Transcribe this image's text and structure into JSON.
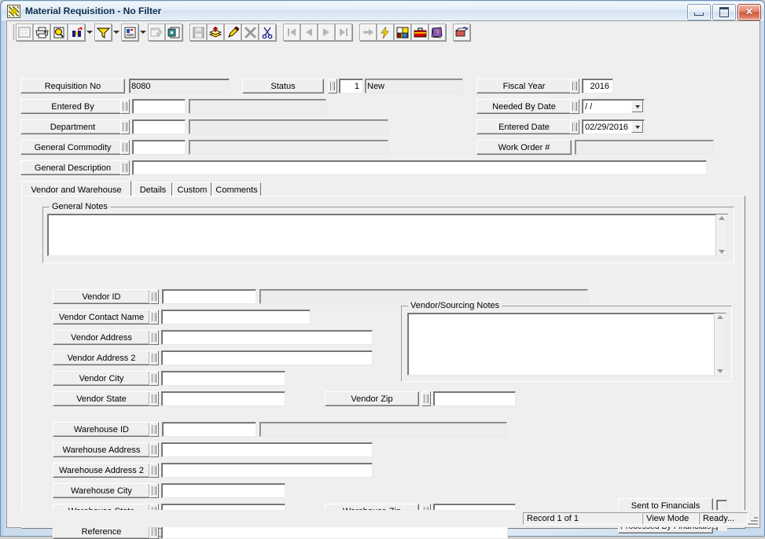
{
  "window": {
    "title": "Material Requisition - No Filter",
    "icon": "application-icon",
    "buttons": [
      {
        "name": "minimize-button",
        "label": "Minimize"
      },
      {
        "name": "maximize-button",
        "label": "Maximize"
      },
      {
        "name": "close-button",
        "label": "Close"
      }
    ]
  },
  "toolbar": {
    "items": [
      {
        "name": "grid-view-button",
        "icon": "grid-icon",
        "enabled": false
      },
      {
        "name": "print-button",
        "icon": "printer-icon",
        "enabled": true
      },
      {
        "name": "print-preview-button",
        "icon": "magnifier-page-icon",
        "enabled": true
      },
      {
        "name": "find-button",
        "icon": "binoculars-icon",
        "enabled": true
      },
      {
        "name": "find-dropdown",
        "icon": "chevron-down-icon",
        "enabled": true
      },
      {
        "name": "filter-button",
        "icon": "funnel-icon",
        "enabled": true
      },
      {
        "name": "filter-dropdown",
        "icon": "chevron-down-icon",
        "enabled": true
      },
      {
        "name": "report-button",
        "icon": "document-report-icon",
        "enabled": true
      },
      {
        "name": "report-dropdown",
        "icon": "chevron-down-icon",
        "enabled": true
      },
      {
        "name": "properties-button",
        "icon": "window-properties-icon",
        "enabled": false
      },
      {
        "name": "export-button",
        "icon": "export-page-icon",
        "enabled": true
      },
      {
        "name": "save-button",
        "icon": "floppy-disk-icon",
        "enabled": false
      },
      {
        "name": "add-record-button",
        "icon": "add-layers-icon",
        "enabled": true
      },
      {
        "name": "edit-record-button",
        "icon": "pencil-icon",
        "enabled": true
      },
      {
        "name": "delete-record-button",
        "icon": "x-delete-icon",
        "enabled": false
      },
      {
        "name": "cut-button",
        "icon": "scissors-icon",
        "enabled": true
      },
      {
        "name": "first-record-button",
        "icon": "first-record-icon",
        "enabled": false
      },
      {
        "name": "previous-record-button",
        "icon": "previous-record-icon",
        "enabled": false
      },
      {
        "name": "next-record-button",
        "icon": "next-record-icon",
        "enabled": false
      },
      {
        "name": "last-record-button",
        "icon": "last-record-icon",
        "enabled": false
      },
      {
        "name": "goto-button",
        "icon": "arrow-right-icon",
        "enabled": false
      },
      {
        "name": "quick-action-button",
        "icon": "lightning-bolt-icon",
        "enabled": true
      },
      {
        "name": "attachments-button",
        "icon": "paint-palette-icon",
        "enabled": true
      },
      {
        "name": "toolbox-button",
        "icon": "toolbox-icon",
        "enabled": true
      },
      {
        "name": "help-button",
        "icon": "help-book-icon",
        "enabled": true
      },
      {
        "name": "exit-button",
        "icon": "exit-door-icon",
        "enabled": true
      }
    ]
  },
  "header": {
    "requisition_no": {
      "label": "Requisition No",
      "value": "8080"
    },
    "status": {
      "label": "Status",
      "code": "1",
      "description": "New"
    },
    "entered_by": {
      "label": "Entered By",
      "value": "",
      "desc": ""
    },
    "department": {
      "label": "Department",
      "value": "",
      "desc": ""
    },
    "general_commodity": {
      "label": "General Commodity",
      "value": "",
      "desc": ""
    },
    "general_description": {
      "label": "General Description",
      "value": ""
    },
    "fiscal_year": {
      "label": "Fiscal Year",
      "value": "2016"
    },
    "needed_by_date": {
      "label": "Needed By Date",
      "value": "  /  /"
    },
    "entered_date": {
      "label": "Entered Date",
      "value": "02/29/2016"
    },
    "work_order": {
      "label": "Work Order #",
      "value": ""
    }
  },
  "tabs": [
    {
      "label": "Vendor and Warehouse",
      "selected": true
    },
    {
      "label": "Details",
      "selected": false
    },
    {
      "label": "Custom",
      "selected": false
    },
    {
      "label": "Comments",
      "selected": false
    }
  ],
  "vendor_warehouse": {
    "general_notes": {
      "legend": "General Notes",
      "value": ""
    },
    "vendor_sourcing_notes": {
      "legend": "Vendor/Sourcing Notes",
      "value": ""
    },
    "vendor": {
      "vendor_id": {
        "label": "Vendor ID",
        "value": "",
        "desc": ""
      },
      "vendor_contact_name": {
        "label": "Vendor Contact Name",
        "value": ""
      },
      "vendor_address": {
        "label": "Vendor Address",
        "value": ""
      },
      "vendor_address_2": {
        "label": "Vendor Address 2",
        "value": ""
      },
      "vendor_city": {
        "label": "Vendor City",
        "value": ""
      },
      "vendor_state": {
        "label": "Vendor State",
        "value": ""
      },
      "vendor_zip": {
        "label": "Vendor Zip",
        "value": ""
      }
    },
    "warehouse": {
      "warehouse_id": {
        "label": "Warehouse ID",
        "value": "",
        "desc": ""
      },
      "warehouse_address": {
        "label": "Warehouse  Address",
        "value": ""
      },
      "warehouse_address_2": {
        "label": "Warehouse  Address 2",
        "value": ""
      },
      "warehouse_city": {
        "label": "Warehouse  City",
        "value": ""
      },
      "warehouse_state": {
        "label": "Warehouse  State",
        "value": ""
      },
      "warehouse_zip": {
        "label": "Warehouse Zip",
        "value": ""
      },
      "reference": {
        "label": "Reference",
        "value": ""
      }
    },
    "flags": {
      "sent_to_financials": {
        "label": "Sent to Financials",
        "checked": false
      },
      "processed_by_financials": {
        "label": "Processed By Financials",
        "checked": false
      }
    }
  },
  "statusbar": {
    "record": "Record 1 of 1",
    "mode": "View Mode",
    "state": "Ready..."
  }
}
